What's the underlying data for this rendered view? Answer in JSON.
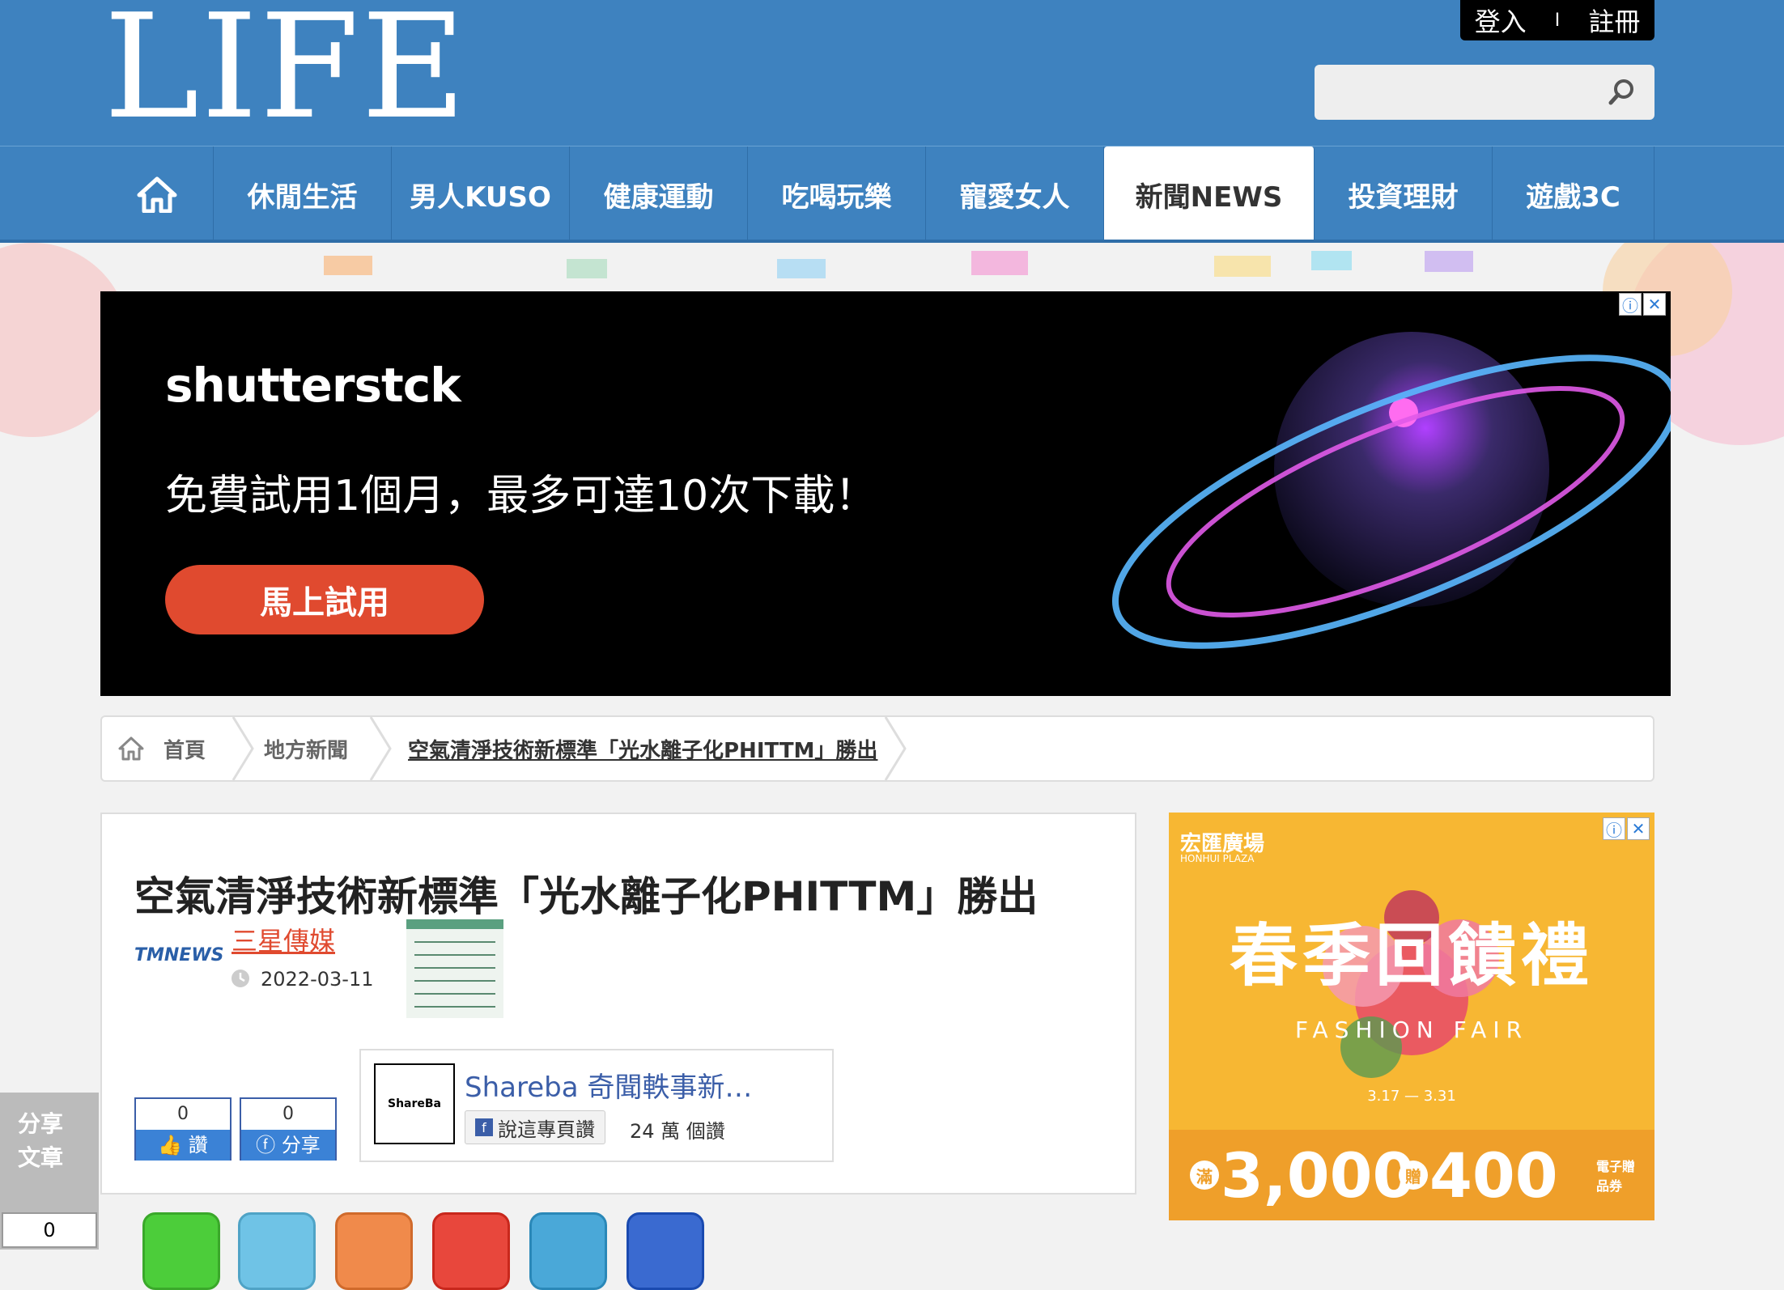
{
  "header": {
    "logo": "LIFE",
    "login": "登入",
    "separator": "I",
    "register": "註冊",
    "search_placeholder": ""
  },
  "nav": {
    "items": [
      {
        "label": "休閒生活"
      },
      {
        "label": "男人KUSO"
      },
      {
        "label": "健康運動"
      },
      {
        "label": "吃喝玩樂"
      },
      {
        "label": "寵愛女人"
      },
      {
        "label": "新聞NEWS",
        "active": true
      },
      {
        "label": "投資理財"
      },
      {
        "label": "遊戲3C"
      }
    ]
  },
  "ad_banner": {
    "brand": "shutterstck",
    "text": "免費試用1個月，最多可達10次下載！",
    "button": "馬上試用"
  },
  "breadcrumb": {
    "home": "首頁",
    "category": "地方新聞",
    "current": "空氣清淨技術新標準「光水離子化PHITTM」勝出"
  },
  "article": {
    "title": "空氣清淨技術新標準「光水離子化PHITTM」勝出",
    "source": "三星傳媒",
    "source_logo_text": "TMNEWS",
    "date": "2022-03-11",
    "like_count": "0",
    "like_label": "讚",
    "share_count": "0",
    "share_label": "分享"
  },
  "fb_box": {
    "page_name": "Shareba 奇聞軼事新…",
    "logo_text": "ShareBa",
    "like_button": "說這專頁讚",
    "likes": "24 萬 個讚"
  },
  "right_ad": {
    "brand": "宏匯廣場",
    "brand_en": "HONHUI PLAZA",
    "headline": "春季回饋禮",
    "sub": "FASHION FAIR",
    "dates": "3.17 — 3.31",
    "offer_a": "3,000",
    "offer_b": "400",
    "offer_note": "電子贈品券",
    "offer_mark_a": "滿",
    "offer_mark_b": "贈"
  },
  "side_share": {
    "label": "分享文章",
    "count": "0"
  },
  "colors": {
    "header_blue": "#3e82bf",
    "accent_red": "#e04a2f",
    "fb_blue": "#3b5ea8"
  }
}
